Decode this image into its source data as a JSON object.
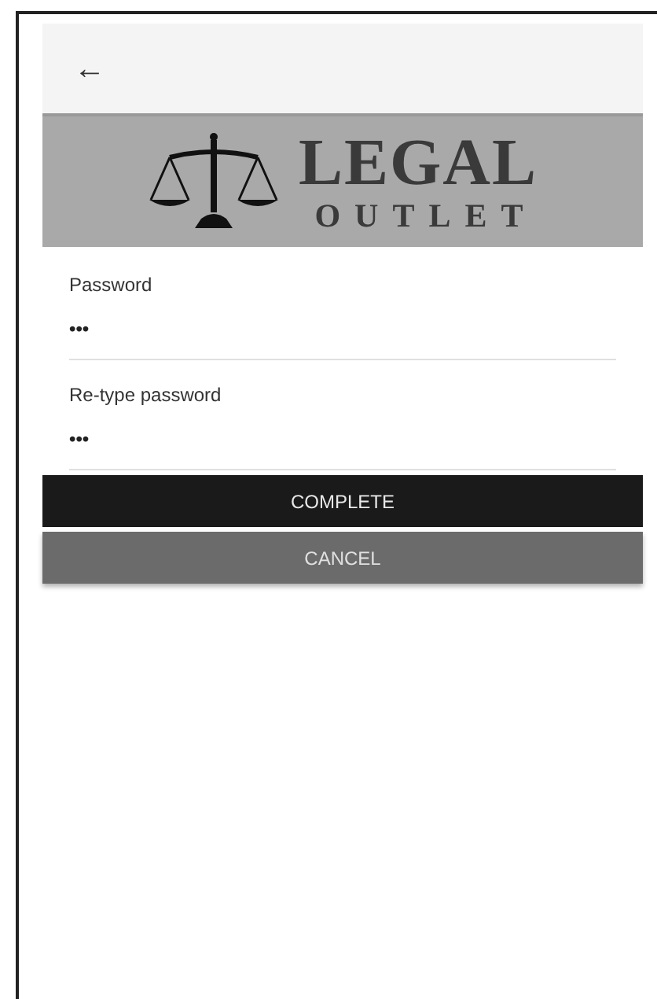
{
  "header": {
    "back": "←"
  },
  "logo": {
    "title": "LEGAL",
    "subtitle": "OUTLET"
  },
  "fields": [
    {
      "label": "Password",
      "value": "•••"
    },
    {
      "label": "Re-type password",
      "value": "•••"
    }
  ],
  "buttons": [
    {
      "label": "COMPLETE",
      "kind": "primary"
    },
    {
      "label": "CANCEL",
      "kind": "secondary"
    }
  ]
}
